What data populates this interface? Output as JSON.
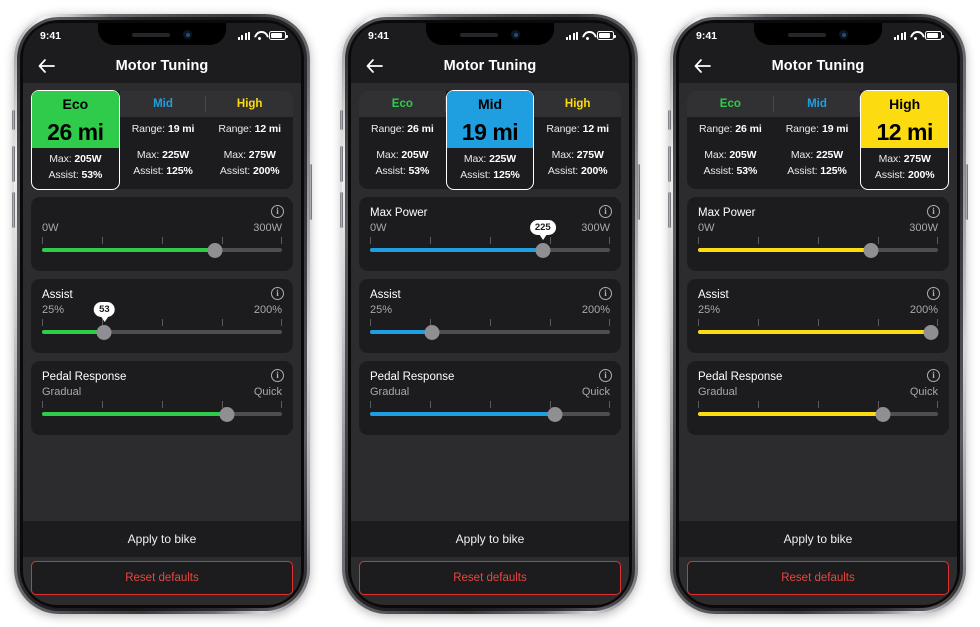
{
  "colors": {
    "eco": "#2ecc4a",
    "mid": "#1f9fe0",
    "high": "#fcdb10",
    "danger": "#e8463f",
    "screen_bg": "#2c2c2e",
    "card_bg": "#1c1c1e"
  },
  "status_bar": {
    "time": "9:41"
  },
  "nav": {
    "title": "Motor Tuning",
    "back_icon": "arrow-left-icon"
  },
  "labels": {
    "range_prefix": "Range:",
    "max_prefix": "Max:",
    "assist_prefix": "Assist:",
    "info_icon": "info-icon"
  },
  "modes": [
    {
      "name": "Eco",
      "range": "26 mi",
      "max": "205W",
      "assist": "53%",
      "accent": "#2ecc4a"
    },
    {
      "name": "Mid",
      "range": "19 mi",
      "max": "225W",
      "assist": "125%",
      "accent": "#1f9fe0"
    },
    {
      "name": "High",
      "range": "12 mi",
      "max": "275W",
      "assist": "200%",
      "accent": "#fcdb10"
    }
  ],
  "sliders": {
    "max_power": {
      "title": "Max Power",
      "min_label": "0W",
      "max_label": "300W"
    },
    "assist": {
      "title": "Assist",
      "min_label": "25%",
      "max_label": "200%"
    },
    "pedal_response": {
      "title": "Pedal Response",
      "min_label": "Gradual",
      "max_label": "Quick"
    }
  },
  "actions": {
    "apply": "Apply to bike",
    "reset": "Reset defaults"
  },
  "phones": [
    {
      "selected_mode": 0,
      "accent": "#2ecc4a",
      "max_power": {
        "show_title": false,
        "percent": 72,
        "bubble": null
      },
      "assist": {
        "show_title": true,
        "percent": 26,
        "bubble": "53"
      },
      "pedal_response": {
        "show_title": true,
        "percent": 77,
        "bubble": null
      }
    },
    {
      "selected_mode": 1,
      "accent": "#1f9fe0",
      "max_power": {
        "show_title": true,
        "percent": 72,
        "bubble": "225"
      },
      "assist": {
        "show_title": true,
        "percent": 26,
        "bubble": null
      },
      "pedal_response": {
        "show_title": true,
        "percent": 77,
        "bubble": null
      }
    },
    {
      "selected_mode": 2,
      "accent": "#fcdb10",
      "max_power": {
        "show_title": true,
        "percent": 72,
        "bubble": null
      },
      "assist": {
        "show_title": true,
        "percent": 97,
        "bubble": null
      },
      "pedal_response": {
        "show_title": true,
        "percent": 77,
        "bubble": null
      }
    }
  ]
}
